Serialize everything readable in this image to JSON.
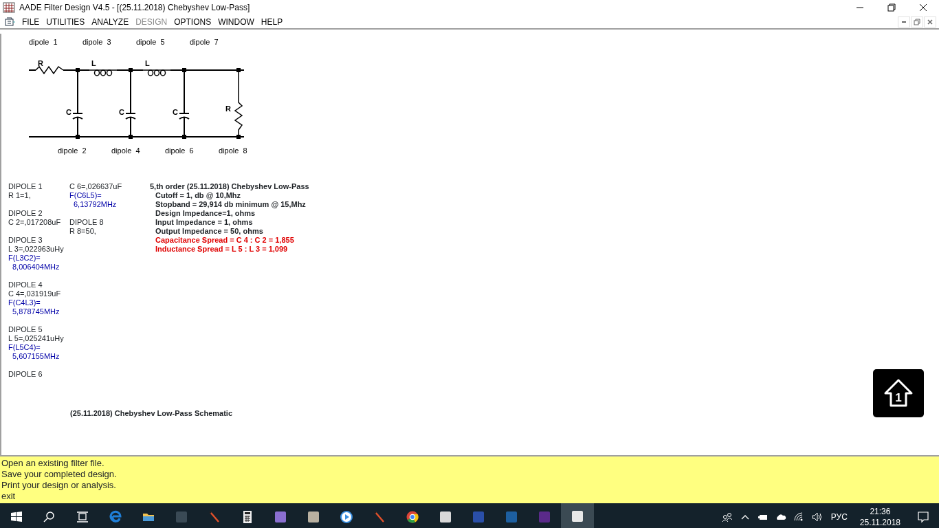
{
  "window": {
    "title": "AADE Filter Design V4.5 - [(25.11.2018) Chebyshev Low-Pass]"
  },
  "menu": [
    {
      "label": "FILE",
      "disabled": false
    },
    {
      "label": "UTILITIES",
      "disabled": false
    },
    {
      "label": "ANALYZE",
      "disabled": false
    },
    {
      "label": "DESIGN",
      "disabled": true
    },
    {
      "label": "OPTIONS",
      "disabled": false
    },
    {
      "label": "WINDOW",
      "disabled": false
    },
    {
      "label": "HELP",
      "disabled": false
    }
  ],
  "schematic": {
    "top_labels": [
      "dipole  1",
      "dipole  3",
      "dipole  5",
      "dipole  7"
    ],
    "bottom_labels": [
      "dipole  2",
      "dipole  4",
      "dipole  6",
      "dipole  8"
    ],
    "series": [
      {
        "kind": "resistor",
        "label": "R"
      },
      {
        "kind": "inductor",
        "label": "L"
      },
      {
        "kind": "inductor",
        "label": "L"
      }
    ],
    "shunt": [
      {
        "kind": "capacitor",
        "label": "C"
      },
      {
        "kind": "capacitor",
        "label": "C"
      },
      {
        "kind": "capacitor",
        "label": "C"
      },
      {
        "kind": "resistor",
        "label": "R"
      }
    ]
  },
  "component_columns": [
    [
      {
        "kind": "heading",
        "text": "DIPOLE 1"
      },
      {
        "kind": "value",
        "text": "R 1=1,"
      },
      {
        "kind": "blank"
      },
      {
        "kind": "heading",
        "text": "DIPOLE 2"
      },
      {
        "kind": "value",
        "text": "C 2=,017208uF"
      },
      {
        "kind": "blank"
      },
      {
        "kind": "heading",
        "text": "DIPOLE 3"
      },
      {
        "kind": "value",
        "text": "L 3=,022963uHy"
      },
      {
        "kind": "freq",
        "text": "F(L3C2)="
      },
      {
        "kind": "freq_value",
        "text": "8,006404MHz"
      },
      {
        "kind": "blank"
      },
      {
        "kind": "heading",
        "text": "DIPOLE 4"
      },
      {
        "kind": "value",
        "text": "C 4=,031919uF"
      },
      {
        "kind": "freq",
        "text": "F(C4L3)="
      },
      {
        "kind": "freq_value",
        "text": "5,878745MHz"
      },
      {
        "kind": "blank"
      },
      {
        "kind": "heading",
        "text": "DIPOLE 5"
      },
      {
        "kind": "value",
        "text": "L 5=,025241uHy"
      },
      {
        "kind": "freq",
        "text": "F(L5C4)="
      },
      {
        "kind": "freq_value",
        "text": "5,607155MHz"
      },
      {
        "kind": "blank"
      },
      {
        "kind": "heading",
        "text": "DIPOLE 6"
      }
    ],
    [
      {
        "kind": "value",
        "text": "C 6=,026637uF"
      },
      {
        "kind": "freq",
        "text": "F(C6L5)="
      },
      {
        "kind": "freq_value",
        "text": "6,13792MHz"
      },
      {
        "kind": "blank"
      },
      {
        "kind": "heading",
        "text": "DIPOLE 8"
      },
      {
        "kind": "value",
        "text": "R 8=50,"
      }
    ]
  ],
  "summary": [
    {
      "kind": "title",
      "text": "5,th order (25.11.2018) Chebyshev Low-Pass"
    },
    {
      "kind": "spec",
      "text": "Cutoff = 1, db @ 10,Mhz"
    },
    {
      "kind": "spec",
      "text": "Stopband = 29,914 db minimum @ 15,Mhz"
    },
    {
      "kind": "spec",
      "text": "Design Impedance=1, ohms"
    },
    {
      "kind": "spec",
      "text": "Input Impedance = 1, ohms"
    },
    {
      "kind": "spec",
      "text": "Output Impedance = 50, ohms"
    },
    {
      "kind": "warning",
      "text": "Capacitance Spread = C 4 : C 2 = 1,855"
    },
    {
      "kind": "warning",
      "text": "Inductance Spread = L 5 : L 3 = 1,099"
    }
  ],
  "caption": "(25.11.2018) Chebyshev Low-Pass Schematic",
  "overlay_button": {
    "glyph": "1"
  },
  "status_bar": [
    "Open an existing filter file.",
    "Save your completed design.",
    "Print your design or analysis.",
    "exit"
  ],
  "taskbar": {
    "apps": [
      {
        "kind": "start",
        "selected": false
      },
      {
        "kind": "search",
        "selected": false
      },
      {
        "kind": "taskview",
        "selected": false
      },
      {
        "kind": "browser",
        "selected": false,
        "color": "#1f7fd8"
      },
      {
        "kind": "folder",
        "selected": false,
        "color": "#f2c14e"
      },
      {
        "kind": "app",
        "selected": false,
        "color": "#3a4a55"
      },
      {
        "kind": "pen",
        "selected": false,
        "color": "#e0502a"
      },
      {
        "kind": "calculator",
        "selected": false,
        "color": "#f0f0f0"
      },
      {
        "kind": "app",
        "selected": false,
        "color": "#8a6fd0"
      },
      {
        "kind": "app",
        "selected": false,
        "color": "#b8b0a0"
      },
      {
        "kind": "play",
        "selected": false,
        "color": "#3a8fe0"
      },
      {
        "kind": "pen",
        "selected": false,
        "color": "#e0502a"
      },
      {
        "kind": "chrome",
        "selected": false,
        "color": "#db4437"
      },
      {
        "kind": "app",
        "selected": false,
        "color": "#d8d8d8"
      },
      {
        "kind": "app",
        "selected": false,
        "color": "#2a4fa8"
      },
      {
        "kind": "app",
        "selected": false,
        "color": "#1d5fa0"
      },
      {
        "kind": "app",
        "selected": false,
        "color": "#5a2a8a"
      },
      {
        "kind": "app",
        "selected": true,
        "color": "#e8e8e8"
      }
    ],
    "language": "РУС",
    "time": "21:36",
    "date": "25.11.2018"
  }
}
